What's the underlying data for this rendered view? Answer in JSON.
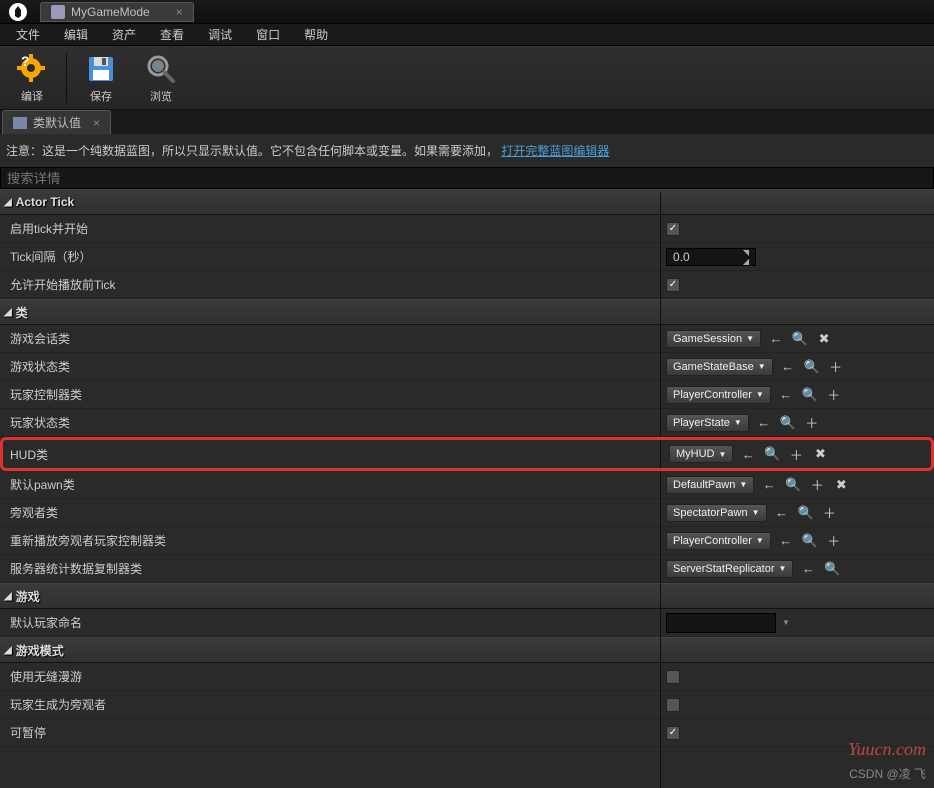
{
  "titlebar": {
    "tab_title": "MyGameMode"
  },
  "menus": [
    "文件",
    "编辑",
    "资产",
    "查看",
    "调试",
    "窗口",
    "帮助"
  ],
  "toolbar": {
    "compile": "编译",
    "save": "保存",
    "browse": "浏览"
  },
  "subtab": {
    "title": "类默认值"
  },
  "info": {
    "text": "注意：这是一个纯数据蓝图，所以只显示默认值。它不包含任何脚本或变量。如果需要添加，",
    "link": "打开完整蓝图编辑器"
  },
  "search": {
    "placeholder": "搜索详情"
  },
  "sections": {
    "actor_tick": {
      "title": "Actor Tick",
      "rows": {
        "enable": {
          "label": "启用tick并开始",
          "checked": true
        },
        "interval": {
          "label": "Tick间隔（秒）",
          "value": "0.0"
        },
        "allow_before": {
          "label": "允许开始播放前Tick",
          "checked": true
        }
      }
    },
    "classes": {
      "title": "类",
      "rows": [
        {
          "label": "游戏会话类",
          "value": "GameSession",
          "icons": [
            "back",
            "search",
            "clear"
          ]
        },
        {
          "label": "游戏状态类",
          "value": "GameStateBase",
          "icons": [
            "back",
            "search",
            "add"
          ]
        },
        {
          "label": "玩家控制器类",
          "value": "PlayerController",
          "icons": [
            "back",
            "search",
            "add"
          ]
        },
        {
          "label": "玩家状态类",
          "value": "PlayerState",
          "icons": [
            "back",
            "search",
            "add"
          ]
        },
        {
          "label": "HUD类",
          "value": "MyHUD",
          "icons": [
            "back",
            "search",
            "add",
            "clear"
          ],
          "highlight": true
        },
        {
          "label": "默认pawn类",
          "value": "DefaultPawn",
          "icons": [
            "back",
            "search",
            "add",
            "clear"
          ]
        },
        {
          "label": "旁观者类",
          "value": "SpectatorPawn",
          "icons": [
            "back",
            "search",
            "add"
          ]
        },
        {
          "label": "重新播放旁观者玩家控制器类",
          "value": "PlayerController",
          "icons": [
            "back",
            "search",
            "add"
          ]
        },
        {
          "label": "服务器统计数据复制器类",
          "value": "ServerStatReplicator",
          "icons": [
            "back",
            "search"
          ]
        }
      ]
    },
    "game": {
      "title": "游戏",
      "rows": {
        "default_player_name": {
          "label": "默认玩家命名",
          "value": ""
        }
      }
    },
    "game_mode": {
      "title": "游戏模式",
      "rows": {
        "seamless": {
          "label": "使用无缝漫游",
          "checked": false
        },
        "spawn_spectator": {
          "label": "玩家生成为旁观者",
          "checked": false
        },
        "pausable": {
          "label": "可暂停",
          "checked": true
        }
      }
    }
  },
  "watermarks": {
    "site": "Yuucn.com",
    "author": "CSDN @凌 飞"
  }
}
